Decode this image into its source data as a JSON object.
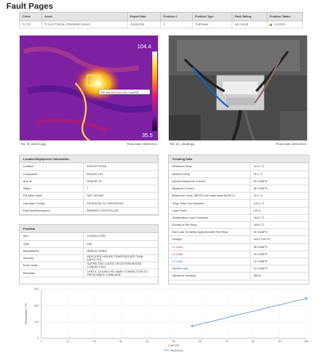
{
  "page": {
    "title": "Fault Pages"
  },
  "header": {
    "columns": [
      "Client",
      "Asset",
      "Report Date",
      "Problem #",
      "Problem Type",
      "Fault Rating",
      "Problem Status"
    ],
    "row": {
      "client": "TI LTD",
      "asset": "TI ELECTRICAL TRENDING DEMO",
      "report_date": "23/03/2018",
      "problem_no": "2",
      "problem_type": "THERMAL",
      "fault_rating": "NO ISSUE",
      "status": "CLOSED"
    },
    "status_color": "#7cb342"
  },
  "thermal": {
    "scale_max": "104.4",
    "scale_min": "35.5",
    "hotspot_label": "HS1 Max 95.8 (cent 103.3 avg 84.8)",
    "file": "File: IR_28157A.jpg",
    "date": "Photo Date: 08/03/2014"
  },
  "visual": {
    "file": "File: DC_28158.jpg",
    "date": "Photo Date: 08/03/2014"
  },
  "location": {
    "title": "Location/Equipment Information",
    "rows": [
      {
        "k": "Location",
        "v": "BOILER ROOM"
      },
      {
        "k": "Component",
        "v": "BOILER CP2"
      },
      {
        "k": "Item ID",
        "v": "BOILER CP"
      },
      {
        "k": "Status",
        "v": "T"
      },
      {
        "k": "PM Work Order",
        "v": "NOT ISSUED"
      },
      {
        "k": "Operation Priority",
        "v": "ESSENTIAL TO OPERATION"
      },
      {
        "k": "Fault Item/Description",
        "v": "BURNER CONTROLLER"
      }
    ]
  },
  "problem": {
    "title": "Problem",
    "rows": [
      {
        "k": "Item",
        "v": "CONTACTORS"
      },
      {
        "k": "Type",
        "v": "63A"
      },
      {
        "k": "Manufacturer",
        "v": "MERLIN GERIN"
      },
      {
        "k": "Anomaly",
        "v": "INDICATED HIGHER TEMPERATURE THAN EXPECTED"
      },
      {
        "k": "Root Cause",
        "v": "SUSPECTED LOOSE OR DETERIORATED CONNECTION"
      },
      {
        "k": "Remedial",
        "v": "CHECK, CLEAN & RE-MAKE CONNECTION TO PRESCRIBED STANDARD"
      }
    ]
  },
  "trending": {
    "title": "Trending Data",
    "rows": [
      {
        "k": "Measured Temp.",
        "v": "121.0 °C"
      },
      {
        "k": "Ambient Temp.",
        "v": "21.0 °C"
      },
      {
        "k": "Nominal Maximum Current",
        "v": "63.0 AMPS"
      },
      {
        "k": "Measured Current",
        "v": "36.0 AMPS"
      },
      {
        "k": "Reference Temp. (BS7671 ref cable temp 65.85°C)",
        "v": "75.0 °C"
      },
      {
        "k": "Temp. Rise Over Ambient",
        "v": "100.0 °C"
      },
      {
        "k": "Load Factor",
        "v": "0.6 %"
      },
      {
        "k": "Temperature Load Corrected",
        "v": "244.4 °C"
      },
      {
        "k": "Excess of Ref Temp.",
        "v": "169.9 °C"
      },
      {
        "k": "Max Load To Safely Apply Beneath Ref Temp.",
        "v": "24.3 AMPS"
      },
      {
        "k": "Voltage",
        "v": "415.0 VOLTS"
      },
      {
        "k": "L1 Load",
        "v": "36.0 AMPS"
      },
      {
        "k": "L2 Load",
        "v": "42.0 AMPS"
      },
      {
        "k": "L3 Load",
        "v": "41.0 AMPS"
      },
      {
        "k": "Neutral Load",
        "v": "10.0 AMPS"
      },
      {
        "k": "Ultrasonic Reading",
        "v": "DBUV"
      }
    ]
  },
  "chart_data": {
    "type": "line",
    "title": "",
    "xlabel": "Load (%)",
    "ylabel": "Temperature (°C)",
    "xlim": [
      0,
      100
    ],
    "ylim": [
      0,
      300
    ],
    "x_ticks": [
      "0",
      "10",
      "20",
      "30",
      "40",
      "50",
      "60",
      "70",
      "80",
      "90",
      "100"
    ],
    "y_ticks": [
      "0",
      "100",
      "200",
      "300"
    ],
    "series": [
      {
        "name": "Reference",
        "color": "#5b9bd5",
        "x": [
          57,
          100
        ],
        "y": [
          75,
          244
        ]
      }
    ],
    "grid": true,
    "legend": "bottom"
  }
}
